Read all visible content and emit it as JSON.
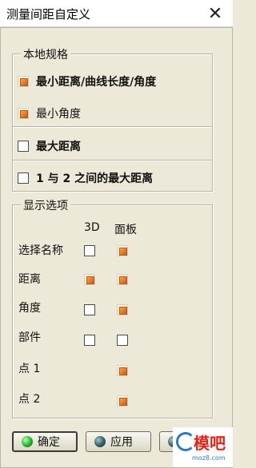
{
  "window": {
    "title": "测量间距自定义",
    "close_symbol": "✕"
  },
  "local_spec": {
    "legend": "本地规格",
    "options": [
      {
        "label": "最小距离/曲线长度/角度",
        "state": "orange",
        "bold": true
      },
      {
        "label": "最小角度",
        "state": "orange",
        "bold": false
      },
      {
        "label": "最大距离",
        "state": "unchecked",
        "bold": true
      },
      {
        "label": "1 与 2 之间的最大距离",
        "state": "unchecked",
        "bold": true
      }
    ]
  },
  "display_options": {
    "legend": "显示选项",
    "col_3d": "3D",
    "col_panel": "面板",
    "rows": [
      {
        "label": "选择名称",
        "d3": "unchecked",
        "panel": "orange"
      },
      {
        "label": "距离",
        "d3": "orange",
        "panel": "orange"
      },
      {
        "label": "角度",
        "d3": "unchecked",
        "panel": "orange"
      },
      {
        "label": "部件",
        "d3": "unchecked",
        "panel": "unchecked"
      },
      {
        "label": "点 1",
        "d3": "none",
        "panel": "orange"
      },
      {
        "label": "点 2",
        "d3": "none",
        "panel": "orange"
      }
    ]
  },
  "buttons": {
    "ok": "确定",
    "apply": "应用",
    "cancel": "取消"
  },
  "watermark": {
    "text": "模吧",
    "url": "moz8.com"
  },
  "colors": {
    "dialog_bg": "#ece9d8",
    "accent_orange": "#e8741f",
    "led_green": "#25b22a"
  }
}
